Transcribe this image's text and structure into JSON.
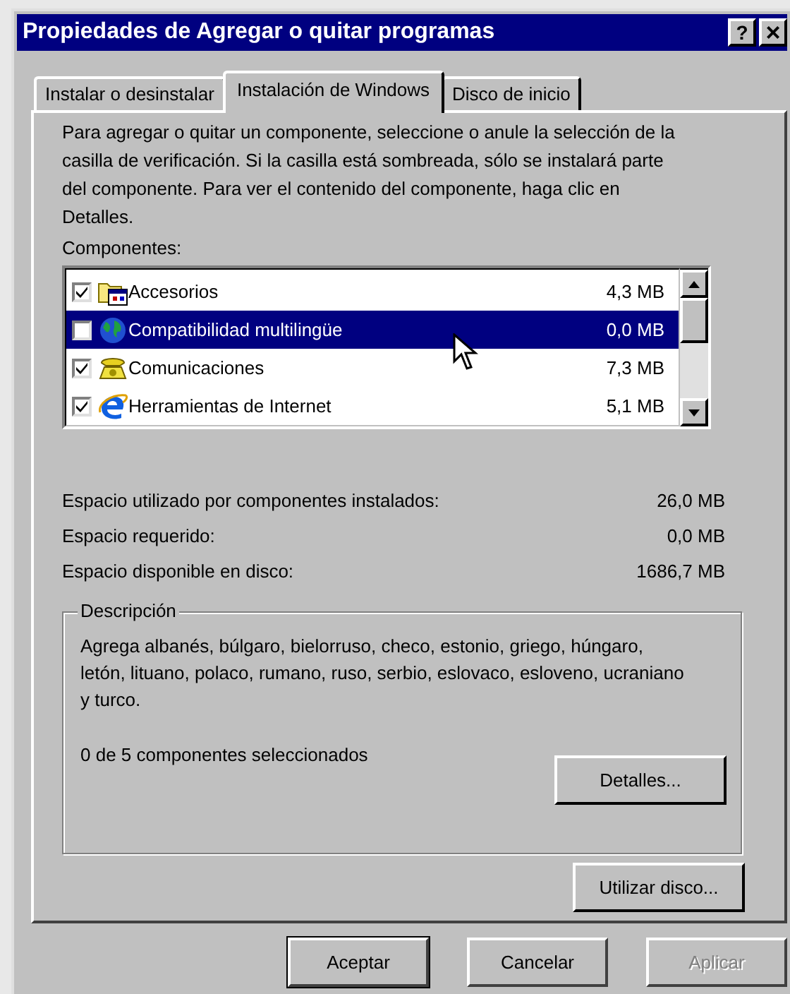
{
  "window": {
    "title": "Propiedades de Agregar o quitar programas",
    "help_button": "?",
    "close_button": "×"
  },
  "tabs": [
    {
      "label": "Instalar o desinstalar",
      "selected": false
    },
    {
      "label": "Instalación de Windows",
      "selected": true
    },
    {
      "label": "Disco de inicio",
      "selected": false
    }
  ],
  "intro": "Para agregar o quitar un componente, seleccione o anule la selección de la casilla de verificación. Si la casilla está sombreada, sólo se instalará parte del componente. Para ver el contenido del componente, haga clic en Detalles.",
  "components_label": "Componentes:",
  "components": [
    {
      "name": "Accesorios",
      "size": "4,3 MB",
      "checked": true,
      "selected": false,
      "kind": "folder"
    },
    {
      "name": "Compatibilidad multilingüe",
      "size": "0,0 MB",
      "checked": false,
      "selected": true,
      "kind": "globe"
    },
    {
      "name": "Comunicaciones",
      "size": "7,3 MB",
      "checked": true,
      "selected": false,
      "kind": "phone"
    },
    {
      "name": "Herramientas de Internet",
      "size": "5,1 MB",
      "checked": true,
      "selected": false,
      "kind": "browser"
    }
  ],
  "stats": [
    {
      "label": "Espacio utilizado por componentes instalados:",
      "value": "26,0 MB"
    },
    {
      "label": "Espacio requerido:",
      "value": "0,0 MB"
    },
    {
      "label": "Espacio disponible en disco:",
      "value": "1686,7 MB"
    }
  ],
  "description": {
    "title": "Descripción",
    "text": "Agrega albanés, búlgaro, bielorruso, checo, estonio, griego, húngaro, letón, lituano, polaco, rumano, ruso, serbio, eslovaco, esloveno, ucraniano y turco.",
    "selection_count": "0 de 5 componentes seleccionados",
    "details_button": "Detalles..."
  },
  "use_disk_button": "Utilizar disco...",
  "buttons": [
    {
      "label": "Aceptar",
      "default": true,
      "disabled": false
    },
    {
      "label": "Cancelar",
      "default": false,
      "disabled": false
    },
    {
      "label": "Aplicar",
      "default": false,
      "disabled": true
    }
  ]
}
